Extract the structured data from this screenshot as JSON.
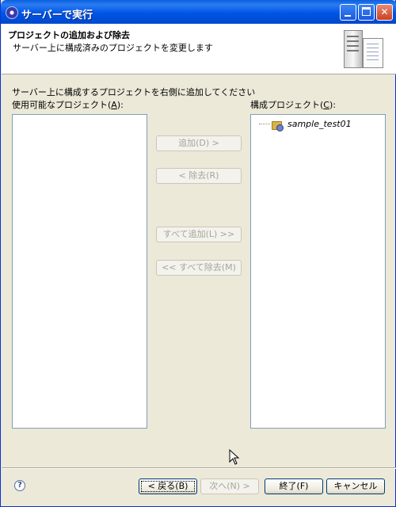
{
  "window": {
    "title": "サーバーで実行"
  },
  "banner": {
    "title": "プロジェクトの追加および除去",
    "description": "サーバー上に構成済みのプロジェクトを変更します"
  },
  "main": {
    "instruction": "サーバー上に構成するプロジェクトを右側に追加してください",
    "available": {
      "label": "使用可能なプロジェクト(",
      "mnemonic": "A",
      "label_end": "):",
      "items": []
    },
    "configured": {
      "label": "構成プロジェクト(",
      "mnemonic": "C",
      "label_end": "):",
      "items": [
        "sample_test01"
      ]
    },
    "buttons": {
      "add": "追加(D) >",
      "remove": "< 除去(R)",
      "add_all": "すべて追加(L) >>",
      "remove_all": "<< すべて除去(M)"
    }
  },
  "footer": {
    "help": "?",
    "back": "< 戻る(B)",
    "next": "次へ(N) >",
    "finish": "終了(F)",
    "cancel": "キャンセル"
  },
  "colors": {
    "titlebar": "#0055e5",
    "dialog_bg": "#ece9d8",
    "list_border": "#7f9db9",
    "disabled_text": "#a7a69a"
  },
  "icons": {
    "window": "eclipse-icon",
    "banner": "server-wizard-icon",
    "project": "web-project-icon",
    "help": "help-icon",
    "cursor": "mouse-pointer-icon"
  }
}
